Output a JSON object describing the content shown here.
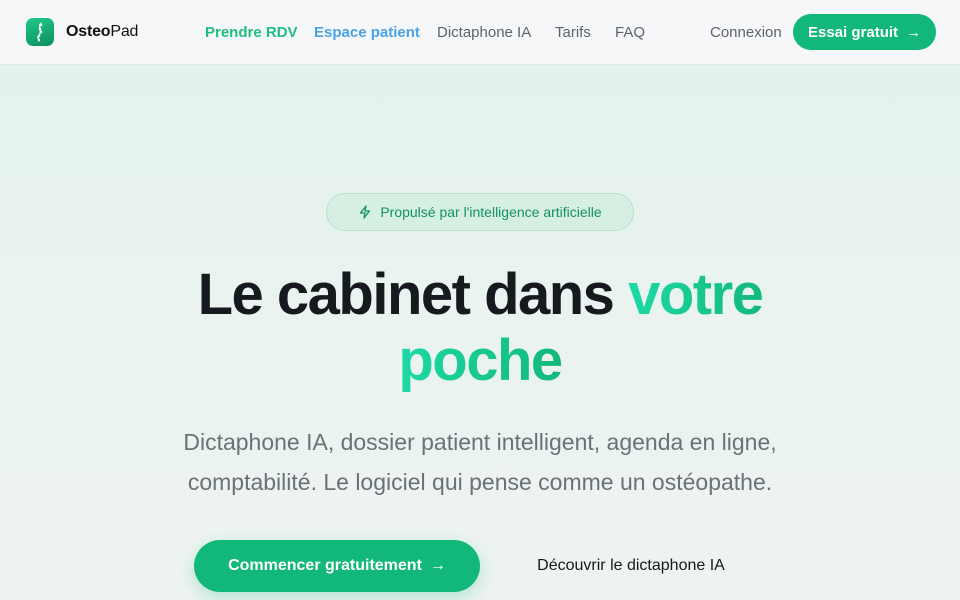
{
  "brand": {
    "name_bold": "Osteo",
    "name_rest": "Pad",
    "accent": "#12b87a"
  },
  "nav": {
    "items": [
      {
        "label": "Prendre RDV",
        "color": "#1fbf7f"
      },
      {
        "label": "Espace patient",
        "color": "#4aa3e6"
      },
      {
        "label": "Dictaphone IA",
        "color": "#5f6368"
      },
      {
        "label": "Tarifs",
        "color": "#5f6368"
      },
      {
        "label": "FAQ",
        "color": "#5f6368"
      }
    ],
    "login_label": "Connexion",
    "trial_label": "Essai gratuit"
  },
  "hero": {
    "badge": "Propulsé par l'intelligence artificielle",
    "title_part1": "Le cabinet dans ",
    "title_highlight_line1": "votre",
    "title_highlight_line2": "poche",
    "subtitle_line1": "Dictaphone IA, dossier patient intelligent, agenda en ligne,",
    "subtitle_line2": "comptabilité. Le logiciel qui pense comme un ostéopathe.",
    "cta_primary": "Commencer gratuitement",
    "cta_secondary": "Découvrir le dictaphone IA"
  },
  "icons": {
    "logo": "spine-icon",
    "badge": "lightning-icon",
    "arrow": "arrow-right-icon"
  }
}
